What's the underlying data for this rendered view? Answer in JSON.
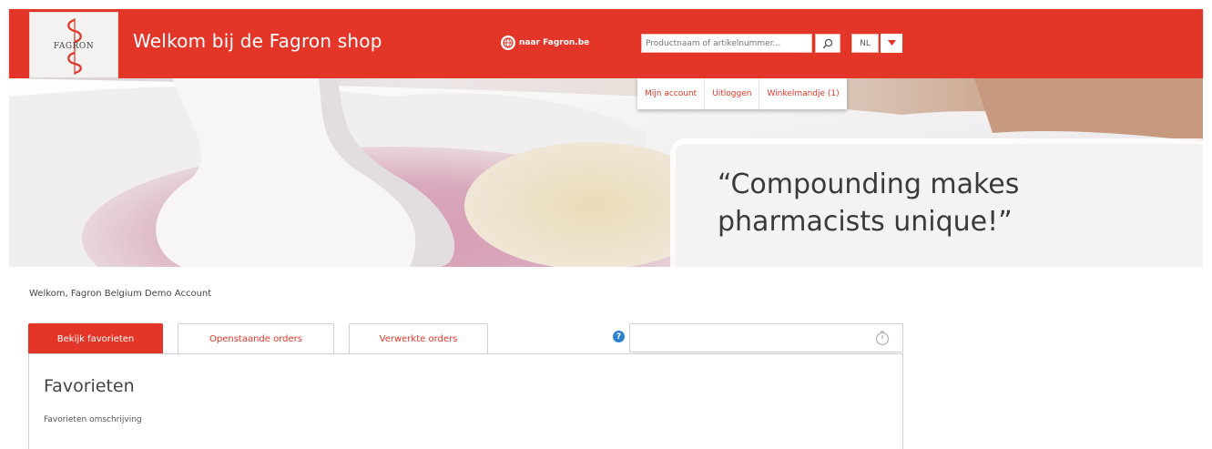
{
  "header": {
    "logo_text": "FAGRON",
    "title": "Welkom bij de Fagron shop",
    "fagron_link": "naar Fagron.be",
    "search_placeholder": "Productnaam of artikelnummer...",
    "language": "NL",
    "brand_color": "#e43628"
  },
  "account_nav": {
    "items": [
      {
        "label": "Mijn account"
      },
      {
        "label": "Uitloggen"
      },
      {
        "label": "Winkelmandje (1)"
      }
    ]
  },
  "hero": {
    "quote": "“Compounding makes pharmacists unique!”"
  },
  "main": {
    "welcome": "Welkom, Fagron Belgium Demo Account",
    "tabs": [
      {
        "label": "Bekijk favorieten",
        "active": true
      },
      {
        "label": "Openstaande orders",
        "active": false
      },
      {
        "label": "Verwerkte orders",
        "active": false
      }
    ],
    "filter_value": "",
    "panel_title": "Favorieten",
    "panel_description": "Favorieten omschrijving"
  },
  "icons": [
    "fagron-logo-icon",
    "globe-icon",
    "search-icon",
    "chevron-down-icon",
    "help-icon",
    "timer-icon"
  ]
}
